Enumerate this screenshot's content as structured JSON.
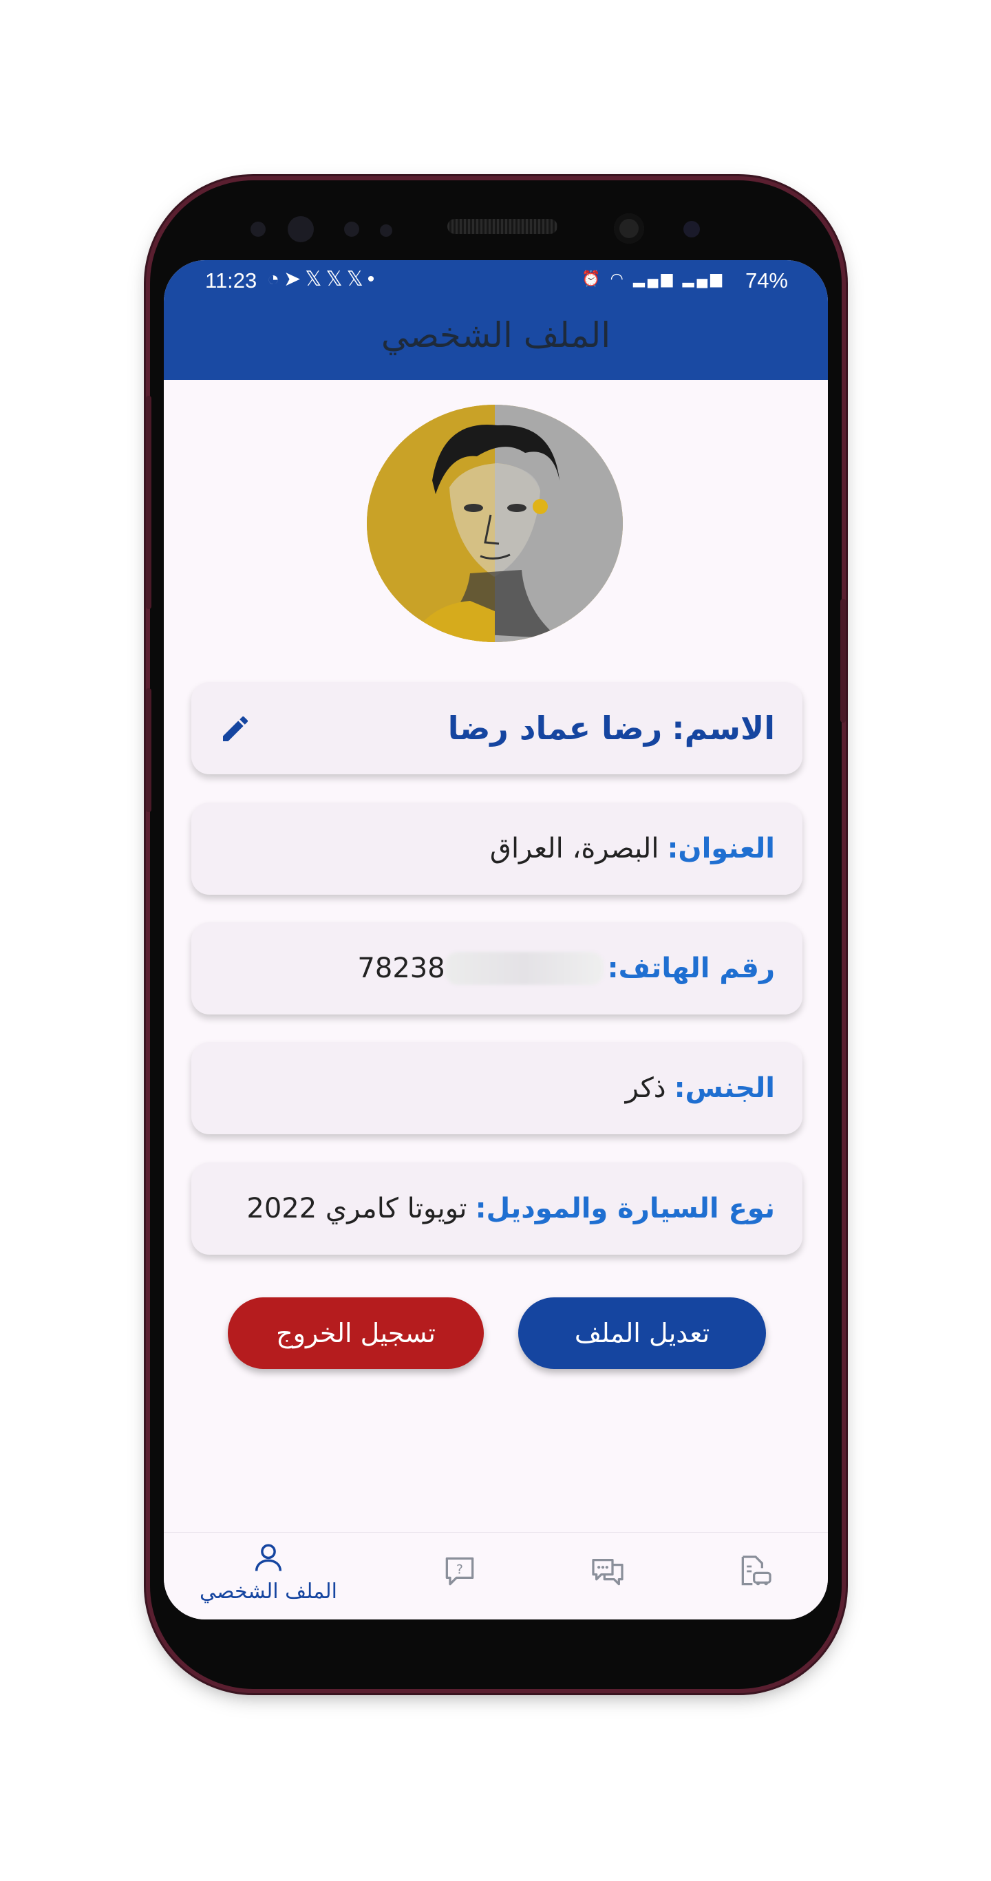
{
  "status_bar": {
    "time": "11:23",
    "left_icons": [
      "whatsapp-icon",
      "telegram-icon",
      "x-icon",
      "x-icon",
      "x-icon",
      "dot-icon"
    ],
    "right_icons": [
      "alarm-icon",
      "wifi-icon",
      "lte1-signal-icon",
      "lte2-signal-icon"
    ],
    "battery": "74%"
  },
  "app_bar": {
    "title": "الملف الشخصي"
  },
  "profile": {
    "name_label": "الاسم:",
    "name_value": "رضا عماد رضا",
    "address_label": "العنوان:",
    "address_value": "البصرة، العراق",
    "phone_label": "رقم الهاتف:",
    "phone_value": "78238",
    "gender_label": "الجنس:",
    "gender_value": "ذكر",
    "car_label": "نوع السيارة والموديل:",
    "car_value": "تويوتا كامري 2022"
  },
  "buttons": {
    "edit_profile": "تعديل الملف",
    "logout": "تسجيل الخروج"
  },
  "bottom_nav": {
    "items": [
      {
        "icon": "person-icon",
        "label": "الملف الشخصي",
        "active": true
      },
      {
        "icon": "help-chat-icon",
        "label": ""
      },
      {
        "icon": "chat-bubbles-icon",
        "label": ""
      },
      {
        "icon": "car-document-icon",
        "label": ""
      }
    ]
  },
  "colors": {
    "primary": "#1a4aa3",
    "label_blue": "#1f6fd1",
    "logout_red": "#b51c1e",
    "background": "#fcf7fc",
    "card": "#f5eff6"
  }
}
